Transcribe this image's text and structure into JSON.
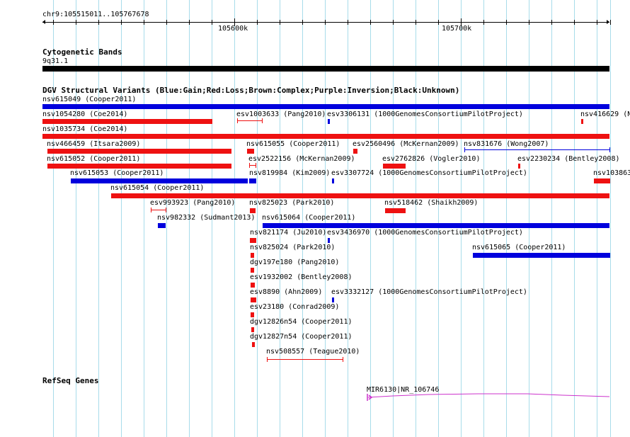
{
  "ruler": {
    "region": "chr9:105515011..105767678",
    "ticks": [
      "105600k",
      "105700k"
    ]
  },
  "tracks": {
    "cytoband_title": "Cytogenetic Bands",
    "cytoband_name": "9q31.1",
    "dgv_title": "DGV Structural Variants (Blue:Gain;Red:Loss;Brown:Complex;Purple:Inversion;Black:Unknown)",
    "refseq_title": "RefSeq Genes"
  },
  "colors": {
    "gain": "#0000dd",
    "loss": "#ee1111",
    "gene": "#cc33cc",
    "grid": "#a8dcea"
  },
  "variants": [
    {
      "label": "nsv615049 (Cooper2011)",
      "type": "gain"
    },
    {
      "label": "nsv1054280 (Coe2014)",
      "type": "loss"
    },
    {
      "label": "esv1003633 (Pang2010)",
      "type": "loss"
    },
    {
      "label": "esv3306131 (1000GenomesConsortiumPilotProject)",
      "type": "gain"
    },
    {
      "label": "nsv416629 (N",
      "type": "loss"
    },
    {
      "label": "nsv1035734 (Coe2014)",
      "type": "loss"
    },
    {
      "label": "nsv466459 (Itsara2009)",
      "type": "loss"
    },
    {
      "label": "nsv615055 (Cooper2011)",
      "type": "loss"
    },
    {
      "label": "esv2560496 (McKernan2009)",
      "type": "loss"
    },
    {
      "label": "nsv831676 (Wong2007)",
      "type": "gain"
    },
    {
      "label": "nsv615052 (Cooper2011)",
      "type": "loss"
    },
    {
      "label": "esv2522156 (McKernan2009)",
      "type": "loss"
    },
    {
      "label": "esv2762826 (Vogler2010)",
      "type": "loss"
    },
    {
      "label": "esv2230234 (Bentley2008)",
      "type": "loss"
    },
    {
      "label": "nsv615053 (Cooper2011)",
      "type": "gain"
    },
    {
      "label": "nsv819984 (Kim2009)",
      "type": "gain"
    },
    {
      "label": "esv3307724 (1000GenomesConsortiumPilotProject)",
      "type": "gain"
    },
    {
      "label": "nsv103863",
      "type": "loss"
    },
    {
      "label": "nsv615054 (Cooper2011)",
      "type": "loss"
    },
    {
      "label": "esv993923 (Pang2010)",
      "type": "loss"
    },
    {
      "label": "nsv825023 (Park2010)",
      "type": "loss"
    },
    {
      "label": "nsv518462 (Shaikh2009)",
      "type": "loss"
    },
    {
      "label": "nsv982332 (Sudmant2013)",
      "type": "gain"
    },
    {
      "label": "nsv615064 (Cooper2011)",
      "type": "gain"
    },
    {
      "label": "nsv821174 (Ju2010)",
      "type": "loss"
    },
    {
      "label": "esv3436970 (1000GenomesConsortiumPilotProject)",
      "type": "gain"
    },
    {
      "label": "nsv825024 (Park2010)",
      "type": "loss"
    },
    {
      "label": "nsv615065 (Cooper2011)",
      "type": "gain"
    },
    {
      "label": "dgv197e180 (Pang2010)",
      "type": "loss"
    },
    {
      "label": "esv1932002 (Bentley2008)",
      "type": "loss"
    },
    {
      "label": "esv8890 (Ahn2009)",
      "type": "loss"
    },
    {
      "label": "esv3332127 (1000GenomesConsortiumPilotProject)",
      "type": "gain"
    },
    {
      "label": "esv23180 (Conrad2009)",
      "type": "loss"
    },
    {
      "label": "dgv12826n54 (Cooper2011)",
      "type": "loss"
    },
    {
      "label": "dgv12827n54 (Cooper2011)",
      "type": "loss"
    },
    {
      "label": "nsv508557 (Teague2010)",
      "type": "loss"
    }
  ],
  "gene": {
    "label": "MIR6130|NR_106746"
  }
}
